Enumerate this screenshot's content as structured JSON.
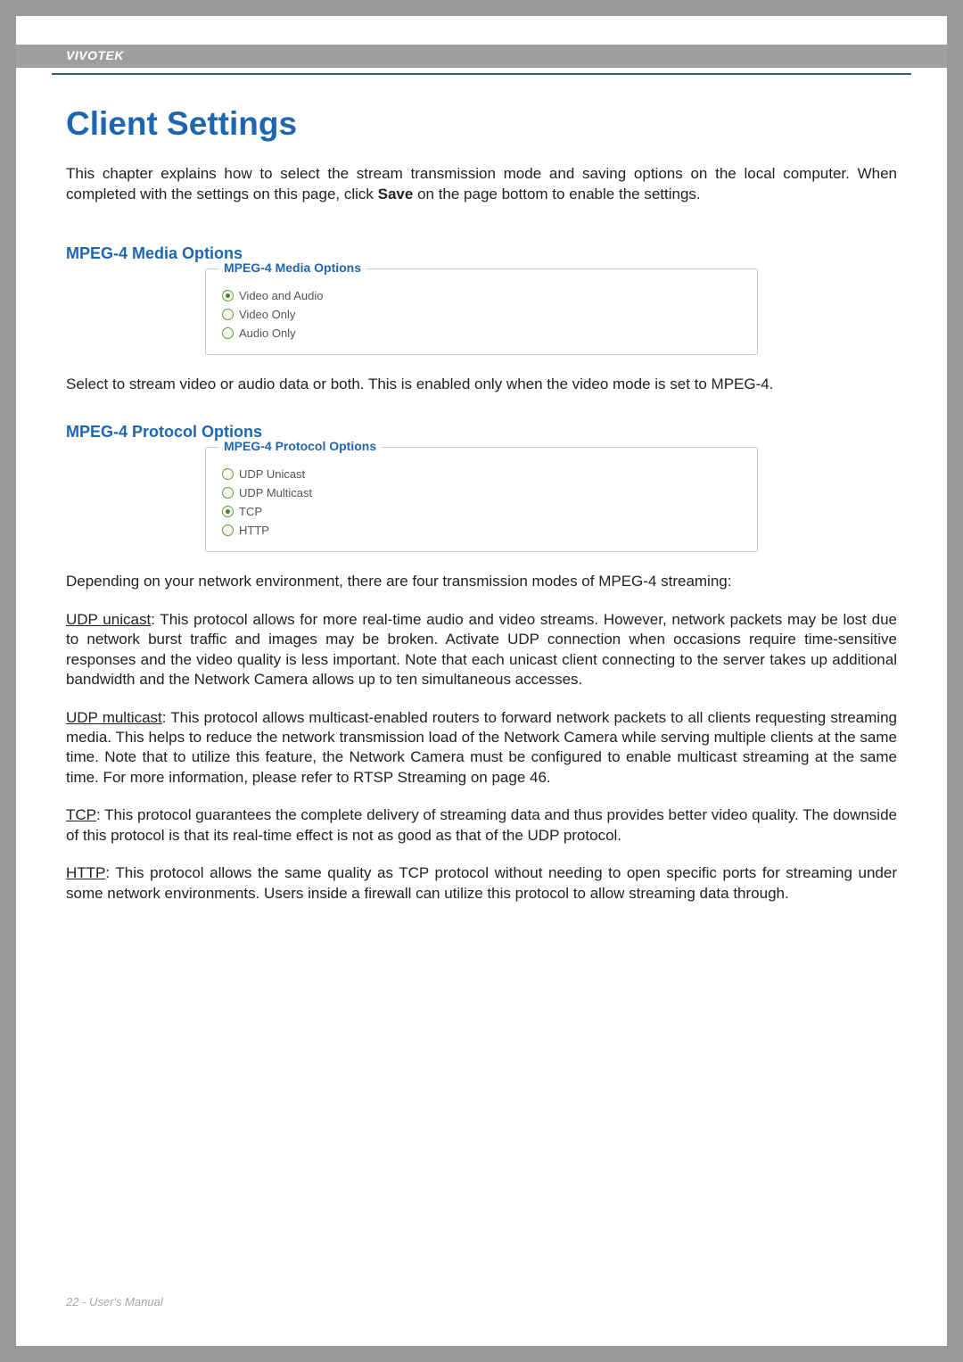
{
  "header": {
    "brand": "VIVOTEK"
  },
  "title": "Client Settings",
  "intro_parts": {
    "p1": "This chapter explains how to select the stream transmission mode and saving options on the local computer. When completed with the settings on this page, click ",
    "save": "Save",
    "p2": " on the page bottom to enable the settings."
  },
  "section1": {
    "heading": "MPEG-4 Media Options",
    "legend": "MPEG-4 Media Options",
    "options": [
      {
        "label": "Video and Audio",
        "checked": true
      },
      {
        "label": "Video Only",
        "checked": false
      },
      {
        "label": "Audio Only",
        "checked": false
      }
    ],
    "desc": "Select to stream video or audio data or both. This is enabled only when the video mode is set to MPEG-4."
  },
  "section2": {
    "heading": "MPEG-4 Protocol Options",
    "legend": "MPEG-4 Protocol Options",
    "options": [
      {
        "label": "UDP Unicast",
        "checked": false
      },
      {
        "label": "UDP Multicast",
        "checked": false
      },
      {
        "label": "TCP",
        "checked": true
      },
      {
        "label": "HTTP",
        "checked": false
      }
    ],
    "intro": "Depending on your network environment, there are four transmission modes of MPEG-4 streaming:",
    "protocols": {
      "udp_unicast": {
        "name": "UDP unicast",
        "text": ": This protocol allows for more real-time audio and video streams. However, network packets may be lost due to network burst traffic and images may be broken. Activate UDP connection when occasions require time-sensitive responses and the video quality is less important. Note that each unicast client connecting to the server takes up additional bandwidth and the Network Camera allows up to ten simultaneous accesses."
      },
      "udp_multicast": {
        "name": "UDP multicast",
        "text": ": This protocol allows multicast-enabled routers to forward network packets to all clients requesting streaming media. This helps to reduce the network transmission load of the Network Camera while serving multiple clients at the same time. Note that to utilize this feature, the Network Camera must be configured to enable multicast streaming at the same time. For more information, please refer to RTSP Streaming on page 46."
      },
      "tcp": {
        "name": "TCP",
        "text": ": This protocol guarantees the complete delivery of streaming data and thus provides better video quality. The downside of this protocol is that its real-time effect is not as good as that of the UDP protocol."
      },
      "http": {
        "name": "HTTP",
        "text": ": This protocol allows the same quality as TCP protocol without needing to open specific ports for streaming under some network environments. Users inside a firewall can utilize this protocol to allow streaming data through."
      }
    }
  },
  "footer": {
    "page": "22",
    "sep": " - ",
    "label": "User's Manual"
  }
}
